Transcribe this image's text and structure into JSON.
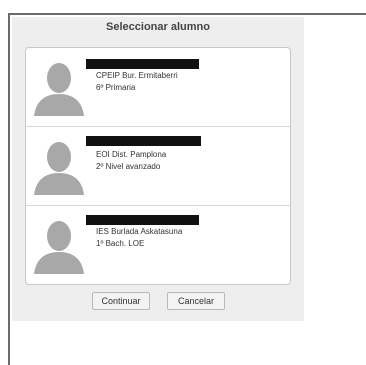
{
  "dialog": {
    "title": "Seleccionar alumno"
  },
  "students": [
    {
      "school": "CPEIP Bur. Ermitaberri",
      "grade": "6º Primaria"
    },
    {
      "school": "EOI Dist. Pamplona",
      "grade": "2º Nivel avanzado"
    },
    {
      "school": "IES Burlada Askatasuna",
      "grade": "1º Bach. LOE"
    }
  ],
  "buttons": {
    "continue_label": "Continuar",
    "cancel_label": "Cancelar"
  },
  "icons": {
    "avatar": "person-silhouette-icon"
  },
  "colors": {
    "dialog_bg": "#eeeeee",
    "avatar": "#a8a8a8",
    "redaction": "#111111"
  }
}
